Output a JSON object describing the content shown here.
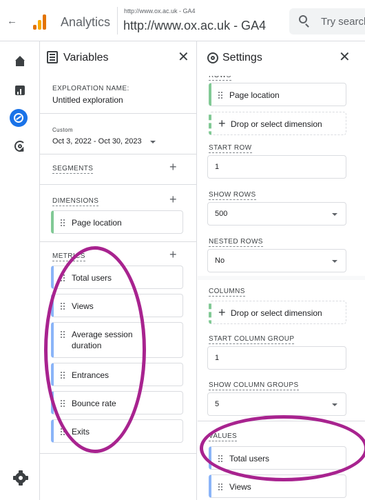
{
  "topbar": {
    "app_title": "Analytics",
    "property_small": "http://www.ox.ac.uk - GA4",
    "property_name": "http://www.ox.ac.uk - GA4",
    "search_placeholder": "Try search"
  },
  "variables_panel": {
    "title": "Variables",
    "exploration_name_label": "EXPLORATION NAME:",
    "exploration_name": "Untitled exploration",
    "date_preset": "Custom",
    "date_range": "Oct 3, 2022 - Oct 30, 2023",
    "segments_label": "SEGMENTS",
    "dimensions_label": "DIMENSIONS",
    "dimensions": [
      "Page location"
    ],
    "metrics_label": "METRICS",
    "metrics": [
      "Total users",
      "Views",
      "Average session duration",
      "Entrances",
      "Bounce rate",
      "Exits"
    ]
  },
  "settings_panel": {
    "title": "Settings",
    "rows_label": "ROWS",
    "rows_chip": "Page location",
    "rows_drop": "Drop or select dimension",
    "start_row_label": "START ROW",
    "start_row_value": "1",
    "show_rows_label": "SHOW ROWS",
    "show_rows_value": "500",
    "nested_rows_label": "NESTED ROWS",
    "nested_rows_value": "No",
    "columns_label": "COLUMNS",
    "columns_drop": "Drop or select dimension",
    "start_column_group_label": "START COLUMN GROUP",
    "start_column_group_value": "1",
    "show_column_groups_label": "SHOW COLUMN GROUPS",
    "show_column_groups_value": "5",
    "values_label": "VALUES",
    "values": [
      "Total users",
      "Views"
    ]
  },
  "colors": {
    "annotation": "#a8238f",
    "dimension_accent": "#81c995",
    "metric_accent": "#8ab4f8",
    "explore_active": "#1a73e8"
  },
  "icons": [
    "back-arrow-icon",
    "analytics-logo",
    "search-icon",
    "home-icon",
    "reports-icon",
    "explore-icon",
    "advertising-icon",
    "admin-gear-icon",
    "variables-icon",
    "settings-icon",
    "close-icon",
    "add-icon",
    "drag-handle-icon",
    "dropdown-caret-icon"
  ]
}
